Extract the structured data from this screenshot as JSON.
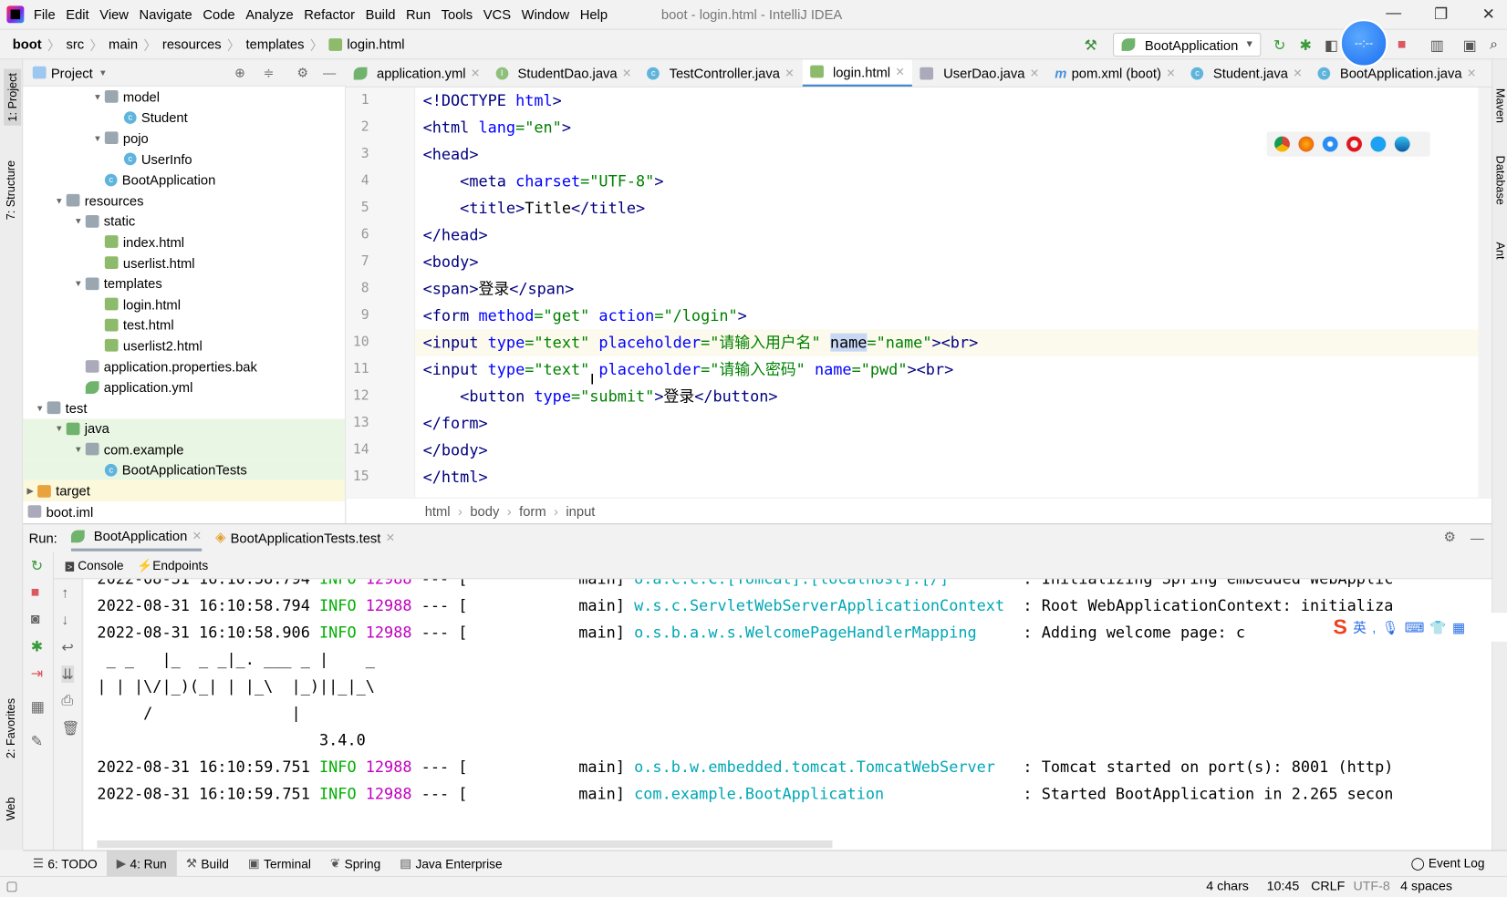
{
  "window": {
    "title": "boot - login.html - IntelliJ IDEA",
    "minimize": "—",
    "restore": "❐",
    "close": "✕"
  },
  "menu": [
    "File",
    "Edit",
    "View",
    "Navigate",
    "Code",
    "Analyze",
    "Refactor",
    "Build",
    "Run",
    "Tools",
    "VCS",
    "Window",
    "Help"
  ],
  "breadcrumb": [
    "boot",
    "src",
    "main",
    "resources",
    "templates",
    "login.html"
  ],
  "toolbar": {
    "run_config": "BootApplication",
    "float_ball": "--:--"
  },
  "left_strip": {
    "project": "1: Project",
    "structure": "7: Structure",
    "favorites": "2: Favorites",
    "web": "Web"
  },
  "right_strip": {
    "maven": "Maven",
    "database": "Database",
    "ant": "Ant"
  },
  "project_panel": {
    "title": "Project"
  },
  "tree": [
    {
      "label": "model",
      "depth": 5,
      "type": "folder",
      "expanded": true
    },
    {
      "label": "Student",
      "depth": 6,
      "type": "class"
    },
    {
      "label": "pojo",
      "depth": 5,
      "type": "folder",
      "expanded": true
    },
    {
      "label": "UserInfo",
      "depth": 6,
      "type": "class"
    },
    {
      "label": "BootApplication",
      "depth": 5,
      "type": "class"
    },
    {
      "label": "resources",
      "depth": 3,
      "type": "folder",
      "expanded": true
    },
    {
      "label": "static",
      "depth": 4,
      "type": "folder",
      "expanded": true
    },
    {
      "label": "index.html",
      "depth": 5,
      "type": "html"
    },
    {
      "label": "userlist.html",
      "depth": 5,
      "type": "html"
    },
    {
      "label": "templates",
      "depth": 4,
      "type": "folder",
      "expanded": true
    },
    {
      "label": "login.html",
      "depth": 5,
      "type": "html"
    },
    {
      "label": "test.html",
      "depth": 5,
      "type": "html"
    },
    {
      "label": "userlist2.html",
      "depth": 5,
      "type": "html"
    },
    {
      "label": "application.properties.bak",
      "depth": 4,
      "type": "file"
    },
    {
      "label": "application.yml",
      "depth": 4,
      "type": "yml"
    },
    {
      "label": "test",
      "depth": 2,
      "type": "folder",
      "expanded": true
    },
    {
      "label": "java",
      "depth": 3,
      "type": "src",
      "expanded": true,
      "bg": "green"
    },
    {
      "label": "com.example",
      "depth": 4,
      "type": "folder",
      "expanded": true,
      "bg": "green"
    },
    {
      "label": "BootApplicationTests",
      "depth": 5,
      "type": "class",
      "bg": "green"
    },
    {
      "label": "target",
      "depth": 1,
      "type": "orange",
      "expanded": false,
      "bg": "yellow"
    },
    {
      "label": "boot.iml",
      "depth": 1,
      "type": "file"
    }
  ],
  "editor_tabs": [
    {
      "label": "application.yml",
      "icon": "yml"
    },
    {
      "label": "StudentDao.java",
      "icon": "interface"
    },
    {
      "label": "TestController.java",
      "icon": "class"
    },
    {
      "label": "login.html",
      "icon": "html",
      "active": true
    },
    {
      "label": "UserDao.java",
      "icon": "file"
    },
    {
      "label": "pom.xml (boot)",
      "icon": "maven"
    },
    {
      "label": "Student.java",
      "icon": "class"
    },
    {
      "label": "BootApplication.java",
      "icon": "class"
    }
  ],
  "code": [
    [
      [
        "t",
        "<!DOCTYPE "
      ],
      [
        "a",
        "html"
      ],
      [
        "t",
        ">"
      ]
    ],
    [
      [
        "t",
        "<html "
      ],
      [
        "a",
        "lang"
      ],
      [
        "v",
        "=\"en\""
      ],
      [
        "t",
        ">"
      ]
    ],
    [
      [
        "t",
        "<head>"
      ]
    ],
    [
      [
        "s",
        "    "
      ],
      [
        "t",
        "<meta "
      ],
      [
        "a",
        "charset"
      ],
      [
        "v",
        "=\"UTF-8\""
      ],
      [
        "t",
        ">"
      ]
    ],
    [
      [
        "s",
        "    "
      ],
      [
        "t",
        "<title>"
      ],
      [
        "s",
        "Title"
      ],
      [
        "t",
        "</title>"
      ]
    ],
    [
      [
        "t",
        "</head>"
      ]
    ],
    [
      [
        "t",
        "<body>"
      ]
    ],
    [
      [
        "t",
        "<span>"
      ],
      [
        "s",
        "登录"
      ],
      [
        "t",
        "</span>"
      ]
    ],
    [
      [
        "t",
        "<form "
      ],
      [
        "a",
        "method"
      ],
      [
        "v",
        "=\"get\" "
      ],
      [
        "a",
        "action"
      ],
      [
        "v",
        "=\"/login\""
      ],
      [
        "t",
        ">"
      ]
    ],
    [
      [
        "t",
        "<input "
      ],
      [
        "a",
        "type"
      ],
      [
        "v",
        "=\"text\" "
      ],
      [
        "a",
        "placeholder"
      ],
      [
        "v",
        "=\"请输入用户名\" "
      ],
      [
        "sel",
        "name"
      ],
      [
        "v",
        "=\"name\""
      ],
      [
        "t",
        "><br>"
      ]
    ],
    [
      [
        "t",
        "<input "
      ],
      [
        "a",
        "type"
      ],
      [
        "v",
        "=\"text\" "
      ],
      [
        "a",
        "placeholder"
      ],
      [
        "v",
        "=\"请输入密码\" "
      ],
      [
        "a",
        "name"
      ],
      [
        "v",
        "=\"pwd\""
      ],
      [
        "t",
        "><br>"
      ]
    ],
    [
      [
        "s",
        "    "
      ],
      [
        "t",
        "<button "
      ],
      [
        "a",
        "type"
      ],
      [
        "v",
        "=\"submit\""
      ],
      [
        "t",
        ">"
      ],
      [
        "s",
        "登录"
      ],
      [
        "t",
        "</button>"
      ]
    ],
    [
      [
        "t",
        "</form>"
      ]
    ],
    [
      [
        "t",
        "</body>"
      ]
    ],
    [
      [
        "t",
        "</html>"
      ]
    ]
  ],
  "current_line": 10,
  "editor_breadcrumb": [
    "html",
    "body",
    "form",
    "input"
  ],
  "run_panel": {
    "label": "Run:",
    "tabs": [
      "BootApplication",
      "BootApplicationTests.test"
    ],
    "console_tabs": [
      "Console",
      "Endpoints"
    ]
  },
  "console": [
    {
      "ts": "2022-08-31 16:10:58.794",
      "level": "INFO",
      "pid": "12988",
      "sep": "--- [",
      "thread": "           main]",
      "logger": "o.a.c.c.C.[Tomcat].[localhost].[/]       ",
      "msg": ": Initializing Spring embedded WebApplic"
    },
    {
      "ts": "2022-08-31 16:10:58.794",
      "level": "INFO",
      "pid": "12988",
      "sep": "--- [",
      "thread": "           main]",
      "logger": "w.s.c.ServletWebServerApplicationContext ",
      "msg": ": Root WebApplicationContext: initializa"
    },
    {
      "ts": "2022-08-31 16:10:58.906",
      "level": "INFO",
      "pid": "12988",
      "sep": "--- [",
      "thread": "           main]",
      "logger": "o.s.b.a.w.s.WelcomePageHandlerMapping    ",
      "msg": ": Adding welcome page: c"
    },
    {
      "raw": " _ _   |_  _ _|_. ___ _ |    _"
    },
    {
      "raw": "| | |\\/|_)(_| | |_\\  |_)||_|_\\"
    },
    {
      "raw": "     /               |"
    },
    {
      "raw": "                        3.4.0"
    },
    {
      "ts": "2022-08-31 16:10:59.751",
      "level": "INFO",
      "pid": "12988",
      "sep": "--- [",
      "thread": "           main]",
      "logger": "o.s.b.w.embedded.tomcat.TomcatWebServer  ",
      "msg": ": Tomcat started on port(s): 8001 (http)"
    },
    {
      "ts": "2022-08-31 16:10:59.751",
      "level": "INFO",
      "pid": "12988",
      "sep": "--- [",
      "thread": "           main]",
      "logger": "com.example.BootApplication              ",
      "msg": ": Started BootApplication in 2.265 secon"
    }
  ],
  "ime": {
    "logo": "S",
    "lang": "英"
  },
  "bottom_tools": [
    "6: TODO",
    "4: Run",
    "Build",
    "Terminal",
    "Spring",
    "Java Enterprise"
  ],
  "event_log": "Event Log",
  "status": {
    "chars": "4 chars",
    "pos": "10:45",
    "eol": "CRLF",
    "enc": "UTF-8",
    "indent": "4 spaces"
  }
}
